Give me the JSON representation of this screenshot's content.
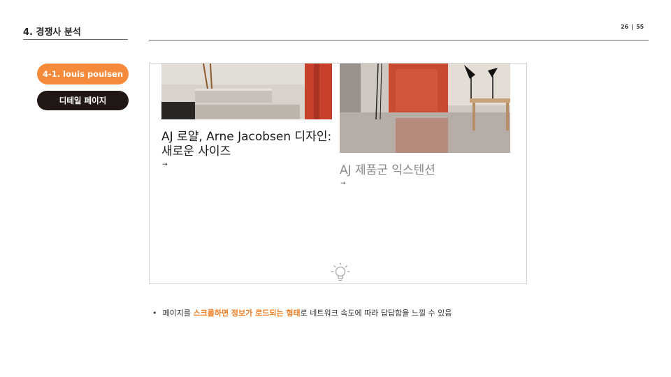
{
  "header": {
    "section_title": "4. 경쟁사 분석",
    "page_current": "26",
    "page_separator": "|",
    "page_total": "55"
  },
  "side_tags": {
    "brand": "4-1. louis poulsen",
    "page_type": "디테일 페이지"
  },
  "preview": {
    "cards": [
      {
        "title": "AJ 로얄, Arne Jacobsen 디자인: 새로운 사이즈",
        "arrow": "→"
      },
      {
        "title": "AJ 제품군 익스텐션",
        "arrow": "→"
      }
    ],
    "loading_icon": "lightbulb-icon"
  },
  "note": {
    "bullet": "•",
    "prefix": "페이지를 ",
    "highlight": "스크롤하면 정보가 로드되는 형태",
    "suffix": "로 네트워크 속도에 따라 답답함을 느낄 수 있음"
  },
  "colors": {
    "accent_orange": "#f58a3b",
    "dark_pill": "#211815",
    "highlight_text": "#f07f24"
  }
}
